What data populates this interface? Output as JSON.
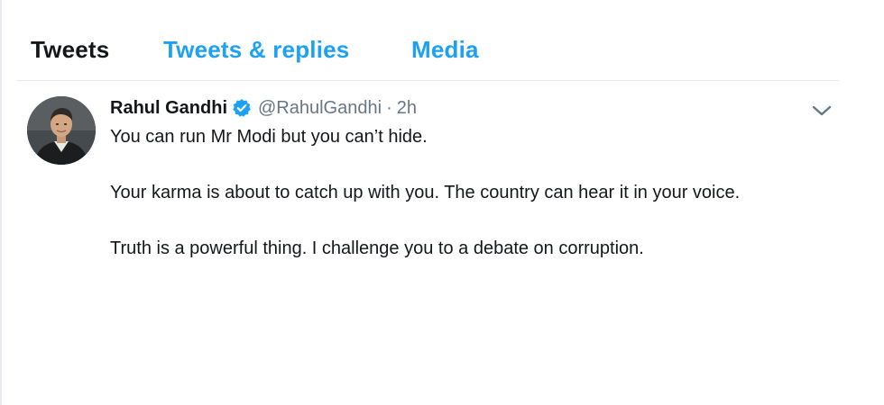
{
  "tabs": [
    {
      "label": "Tweets",
      "active": true
    },
    {
      "label": "Tweets & replies",
      "active": false
    },
    {
      "label": "Media",
      "active": false
    }
  ],
  "tweet": {
    "author_name": "Rahul Gandhi",
    "verified": true,
    "handle": "@RahulGandhi",
    "separator": "·",
    "time": "2h",
    "paragraphs": [
      "You can run Mr Modi but you can’t hide.",
      "Your karma is about to catch up with you. The country can hear it in your voice.",
      "Truth is a powerful thing. I challenge you to a debate on corruption."
    ],
    "menu_icon": "chevron-down-icon",
    "verified_icon": "verified-badge-icon"
  },
  "colors": {
    "accent": "#1da1f2",
    "text": "#14171a",
    "muted": "#657786",
    "divider": "#e6ecf0"
  }
}
